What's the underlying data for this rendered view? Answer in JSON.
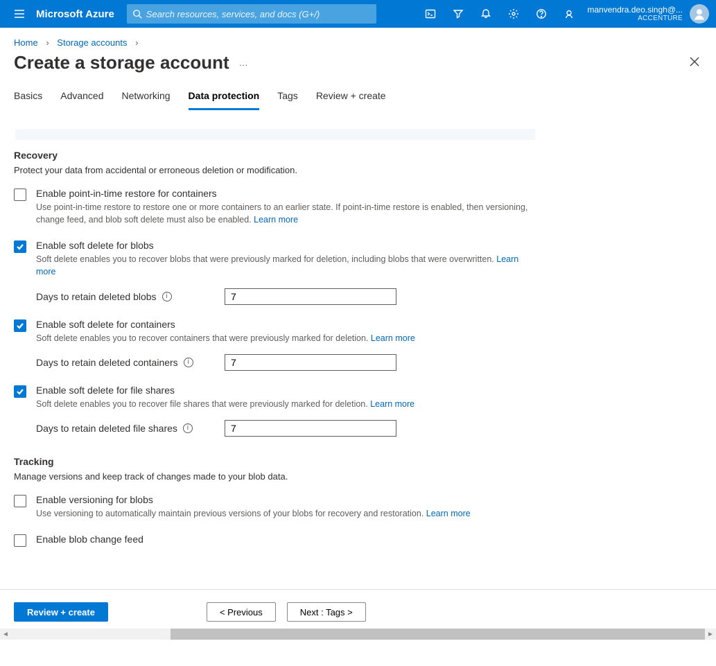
{
  "topbar": {
    "brand": "Microsoft Azure",
    "search_placeholder": "Search resources, services, and docs (G+/)",
    "user": "manvendra.deo.singh@...",
    "tenant": "ACCENTURE"
  },
  "crumbs": {
    "home": "Home",
    "storage": "Storage accounts"
  },
  "page": {
    "title": "Create a storage account",
    "dots": "…"
  },
  "tabs": {
    "basics": "Basics",
    "advanced": "Advanced",
    "networking": "Networking",
    "data_protection": "Data protection",
    "tags": "Tags",
    "review": "Review + create"
  },
  "recovery": {
    "heading": "Recovery",
    "desc": "Protect your data from accidental or erroneous deletion or modification.",
    "pit": {
      "title": "Enable point-in-time restore for containers",
      "desc": "Use point-in-time restore to restore one or more containers to an earlier state. If point-in-time restore is enabled, then versioning, change feed, and blob soft delete must also be enabled. ",
      "learn": "Learn more"
    },
    "soft_blob": {
      "title": "Enable soft delete for blobs",
      "desc": "Soft delete enables you to recover blobs that were previously marked for deletion, including blobs that were overwritten. ",
      "learn": "Learn more",
      "days_label": "Days to retain deleted blobs",
      "days_value": "7"
    },
    "soft_container": {
      "title": "Enable soft delete for containers",
      "desc": "Soft delete enables you to recover containers that were previously marked for deletion. ",
      "learn": "Learn more",
      "days_label": "Days to retain deleted containers",
      "days_value": "7"
    },
    "soft_files": {
      "title": "Enable soft delete for file shares",
      "desc": "Soft delete enables you to recover file shares that were previously marked for deletion. ",
      "learn": "Learn more",
      "days_label": "Days to retain deleted file shares",
      "days_value": "7"
    }
  },
  "tracking": {
    "heading": "Tracking",
    "desc": "Manage versions and keep track of changes made to your blob data.",
    "versioning": {
      "title": "Enable versioning for blobs",
      "desc": "Use versioning to automatically maintain previous versions of your blobs for recovery and restoration. ",
      "learn": "Learn more"
    },
    "changefeed": {
      "title": "Enable blob change feed"
    }
  },
  "footer": {
    "review": "Review + create",
    "prev": "< Previous",
    "next": "Next : Tags >"
  }
}
